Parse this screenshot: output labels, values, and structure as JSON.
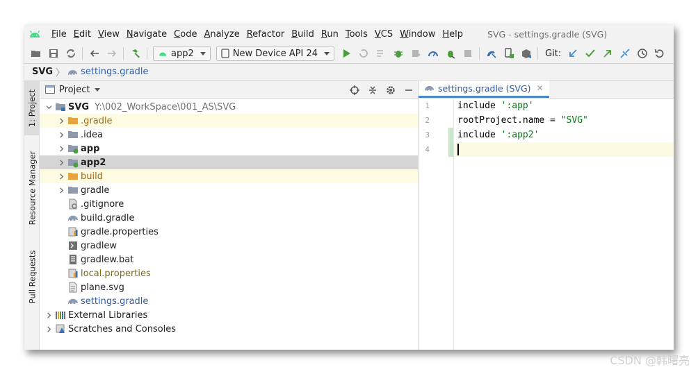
{
  "menu": [
    "File",
    "Edit",
    "View",
    "Navigate",
    "Code",
    "Analyze",
    "Refactor",
    "Build",
    "Run",
    "Tools",
    "VCS",
    "Window",
    "Help"
  ],
  "window_title": "SVG - settings.gradle (SVG)",
  "toolbar": {
    "module_combo": "app2",
    "device_combo": "New Device API 24",
    "git_label": "Git:"
  },
  "breadcrumb": {
    "root": "SVG",
    "file": "settings.gradle"
  },
  "side_tabs": {
    "project": "1: Project",
    "resource_manager": "Resource Manager",
    "pull_requests": "Pull Requests"
  },
  "project_panel": {
    "title": "Project",
    "root_name": "SVG",
    "root_path": "Y:\\002_WorkSpace\\001_AS\\SVG",
    "items": [
      ".gradle",
      ".idea",
      "app",
      "app2",
      "build",
      "gradle",
      ".gitignore",
      "build.gradle",
      "gradle.properties",
      "gradlew",
      "gradlew.bat",
      "local.properties",
      "plane.svg",
      "settings.gradle",
      "External Libraries",
      "Scratches and Consoles"
    ]
  },
  "editor": {
    "tab_label": "settings.gradle (SVG)",
    "line_numbers": [
      "1",
      "2",
      "3",
      "4"
    ],
    "code": [
      {
        "plain": "include ",
        "str": "':app'"
      },
      {
        "plain": "rootProject.name = ",
        "str": "\"SVG\""
      },
      {
        "plain": "include ",
        "str": "':app2'"
      },
      {
        "plain": "",
        "str": ""
      }
    ]
  },
  "watermark": "CSDN @韩曙亮",
  "colors": {
    "accent": "#4a88c7",
    "folder": "#e8a33d",
    "string": "#067d17",
    "selection": "#d5d5d5",
    "highlight": "#fefbe3",
    "android_green": "#3ddc84"
  }
}
